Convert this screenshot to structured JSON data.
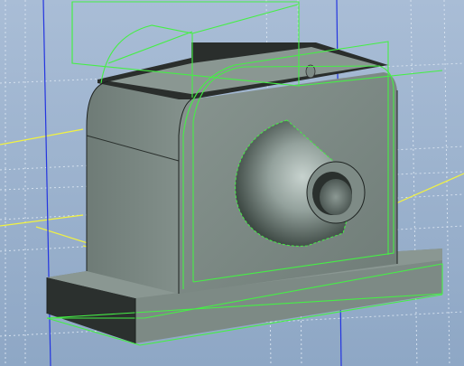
{
  "viewport": {
    "background_top": "#a9bdd6",
    "background_bottom": "#8fa8c6",
    "grid_color": "#c8d9ea"
  },
  "scene": {
    "model_face_color": "#7e8c86",
    "model_dark_color": "#262a28",
    "selection_color": "#44ee44",
    "axis_color": "#2233dd",
    "plane_color": "#f0f038"
  }
}
